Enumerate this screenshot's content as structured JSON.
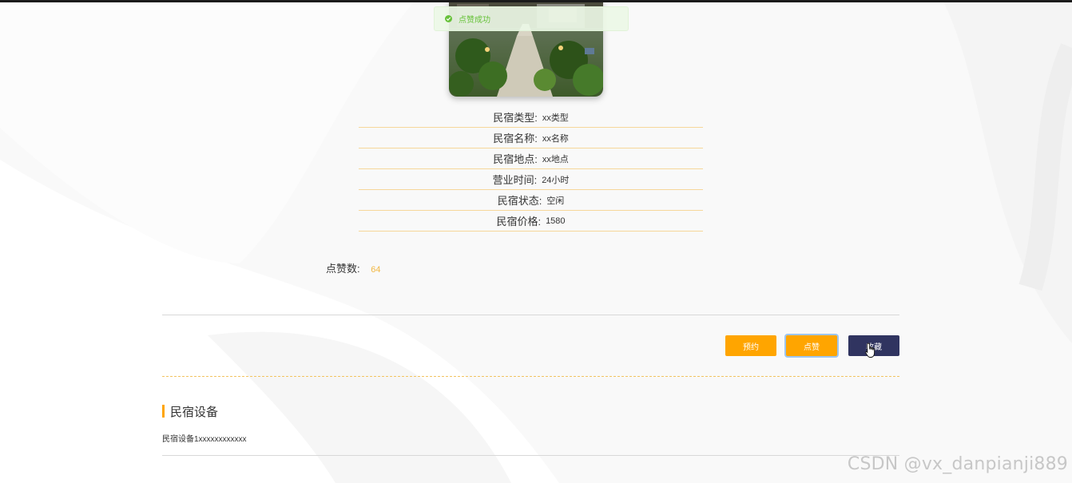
{
  "toast": {
    "icon": "check-circle-icon",
    "message": "点赞成功"
  },
  "image": {
    "alt": "民宿图片"
  },
  "details": [
    {
      "label": "民宿类型:",
      "value": "xx类型"
    },
    {
      "label": "民宿名称:",
      "value": "xx名称"
    },
    {
      "label": "民宿地点:",
      "value": "xx地点"
    },
    {
      "label": "营业时间:",
      "value": "24小时"
    },
    {
      "label": "民宿状态:",
      "value": "空闲"
    },
    {
      "label": "民宿价格:",
      "value": "1580"
    }
  ],
  "likes": {
    "label": "点赞数:",
    "count": "64"
  },
  "actions": {
    "book_label": "预约",
    "like_label": "点赞",
    "favorite_label": "收藏"
  },
  "facilities": {
    "title": "民宿设备",
    "content": "民宿设备1xxxxxxxxxxxx"
  },
  "watermark": "CSDN @vx_danpianji889",
  "colors": {
    "accent": "#ffa500",
    "dark_button": "#303460",
    "success": "#67c23a",
    "likes_count": "#f2b844",
    "row_border": "#f6d79a"
  }
}
